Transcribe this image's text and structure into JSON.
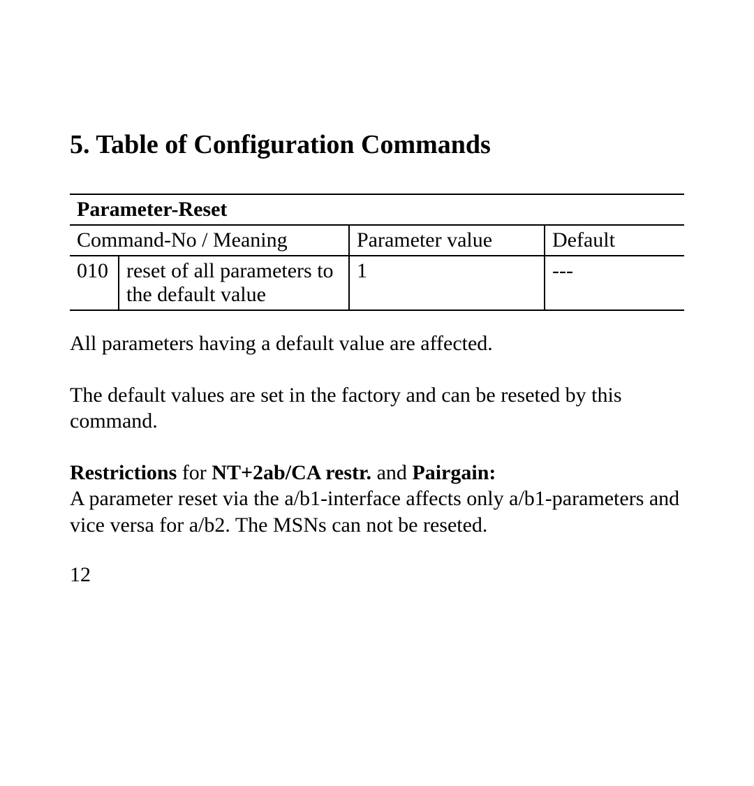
{
  "heading": "5. Table of Configuration Commands",
  "table": {
    "title": "Parameter-Reset",
    "headers": {
      "cmd": "Command-No / Meaning",
      "param": "Parameter value",
      "default": "Default"
    },
    "row": {
      "no": "010",
      "meaning": "reset of all parameters to the default value",
      "param": "1",
      "default": "---"
    }
  },
  "para1": "All parameters having a default value are affected.",
  "para2": "The default values are set in the factory and can be reseted by this command.",
  "restrictions": {
    "label": "Restrictions",
    "for": " for ",
    "device": "NT+2ab/CA restr.",
    "and": " and ",
    "device2": "Pairgain:",
    "body": "A parameter reset via the a/b1-interface affects only a/b1-parameters and vice versa for a/b2. The MSNs can not be reseted."
  },
  "pageNumber": "12"
}
